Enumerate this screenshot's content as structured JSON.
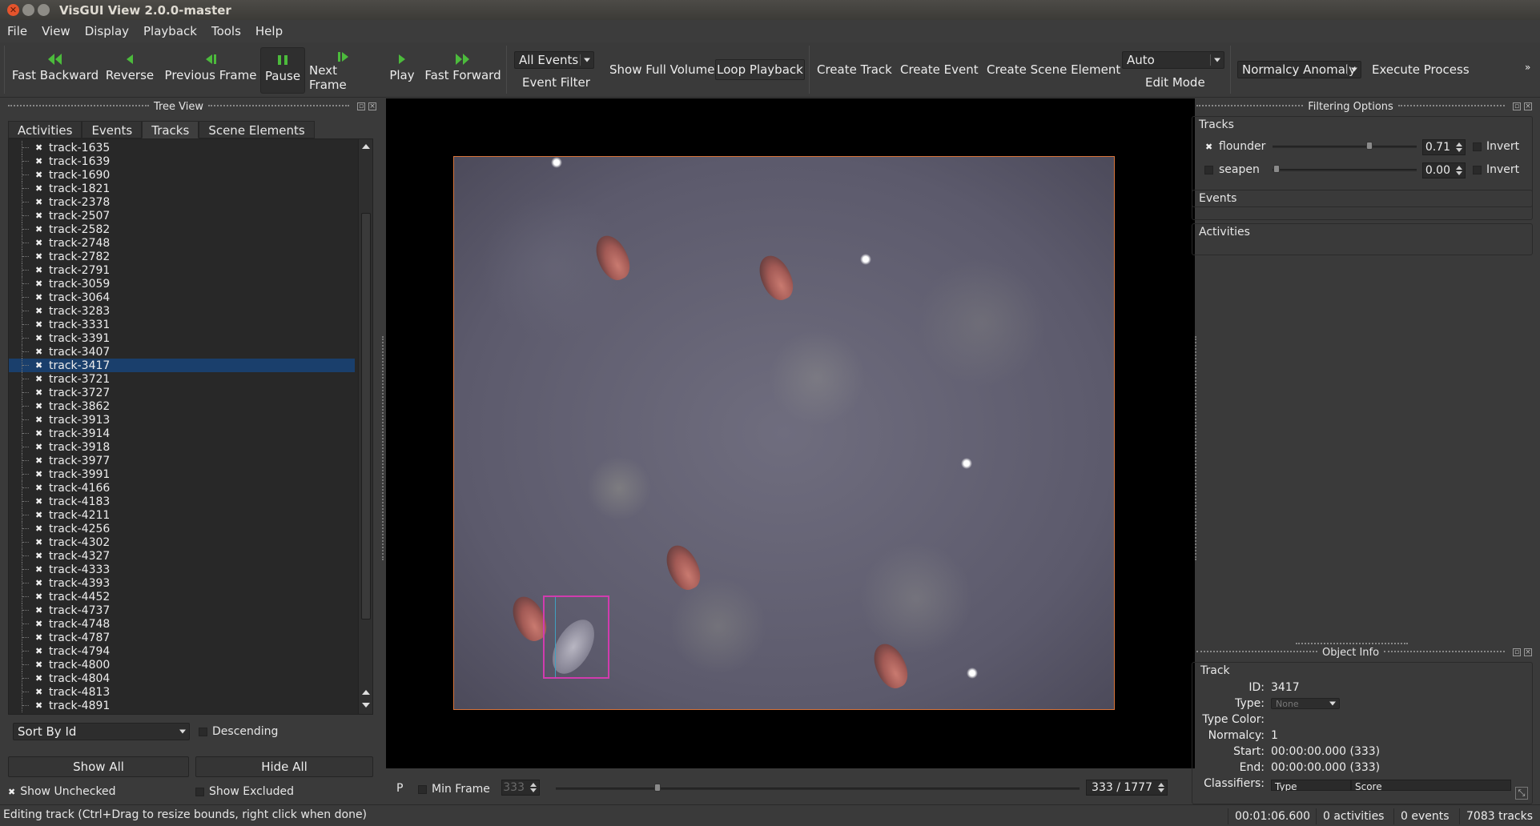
{
  "window": {
    "title": "VisGUI View 2.0.0-master"
  },
  "menu": [
    "File",
    "View",
    "Display",
    "Playback",
    "Tools",
    "Help"
  ],
  "toolbar": {
    "fast_backward": "Fast Backward",
    "reverse": "Reverse",
    "previous_frame": "Previous Frame",
    "pause": "Pause",
    "next_frame": "Next Frame",
    "play": "Play",
    "fast_forward": "Fast Forward",
    "event_filter_value": "All Events",
    "event_filter_label": "Event Filter",
    "show_full_volume": "Show Full Volume",
    "loop_playback": "Loop Playback",
    "create_track": "Create Track",
    "create_event": "Create Event",
    "create_scene_element": "Create Scene Element",
    "edit_mode_value": "Auto",
    "edit_mode_label": "Edit Mode",
    "process_value": "Normalcy Anomaly",
    "execute_process": "Execute Process",
    "overflow": "»"
  },
  "tree_view": {
    "title": "Tree View",
    "tabs": [
      "Activities",
      "Events",
      "Tracks",
      "Scene Elements"
    ],
    "active_tab": "Tracks",
    "tracks": [
      "track-1635",
      "track-1639",
      "track-1690",
      "track-1821",
      "track-2378",
      "track-2507",
      "track-2582",
      "track-2748",
      "track-2782",
      "track-2791",
      "track-3059",
      "track-3064",
      "track-3283",
      "track-3331",
      "track-3391",
      "track-3407",
      "track-3417",
      "track-3721",
      "track-3727",
      "track-3862",
      "track-3913",
      "track-3914",
      "track-3918",
      "track-3977",
      "track-3991",
      "track-4166",
      "track-4183",
      "track-4211",
      "track-4256",
      "track-4302",
      "track-4327",
      "track-4333",
      "track-4393",
      "track-4452",
      "track-4737",
      "track-4748",
      "track-4787",
      "track-4794",
      "track-4800",
      "track-4804",
      "track-4813",
      "track-4891"
    ],
    "selected_track": "track-3417",
    "sort_value": "Sort By Id",
    "descending": "Descending",
    "show_all": "Show All",
    "hide_all": "Hide All",
    "show_unchecked": "Show Unchecked",
    "show_excluded": "Show Excluded"
  },
  "frame_controls": {
    "p_label": "P",
    "min_frame_label": "Min Frame",
    "min_frame_value": "333",
    "frame_position": "333 / 1777"
  },
  "filtering": {
    "title": "Filtering Options",
    "tracks_label": "Tracks",
    "rows": [
      {
        "name": "flounder",
        "checked": true,
        "value": "0.71",
        "invert": "Invert"
      },
      {
        "name": "seapen",
        "checked": false,
        "value": "0.00",
        "invert": "Invert"
      }
    ],
    "events_label": "Events",
    "activities_label": "Activities"
  },
  "object_info": {
    "title": "Object Info",
    "group": "Track",
    "id_label": "ID:",
    "id_value": "3417",
    "type_label": "Type:",
    "type_value": "None",
    "type_color_label": "Type Color:",
    "normalcy_label": "Normalcy:",
    "normalcy_value": "1",
    "start_label": "Start:",
    "start_value": "00:00:00.000 (333)",
    "end_label": "End:",
    "end_value": "00:00:00.000 (333)",
    "classifiers_label": "Classifiers:",
    "classifier_cols": [
      "Type",
      "Score"
    ]
  },
  "status": {
    "message": "Editing track (Ctrl+Drag to resize bounds, right click when done)",
    "time": "00:01:06.600",
    "activities": "0 activities",
    "events": "0 events",
    "tracks": "7083 tracks"
  },
  "colors": {
    "selection": "#1a3f6c",
    "track_box": "#d03cae",
    "frame_border": "#d8743a",
    "play_icon": "#4cbb3c"
  }
}
